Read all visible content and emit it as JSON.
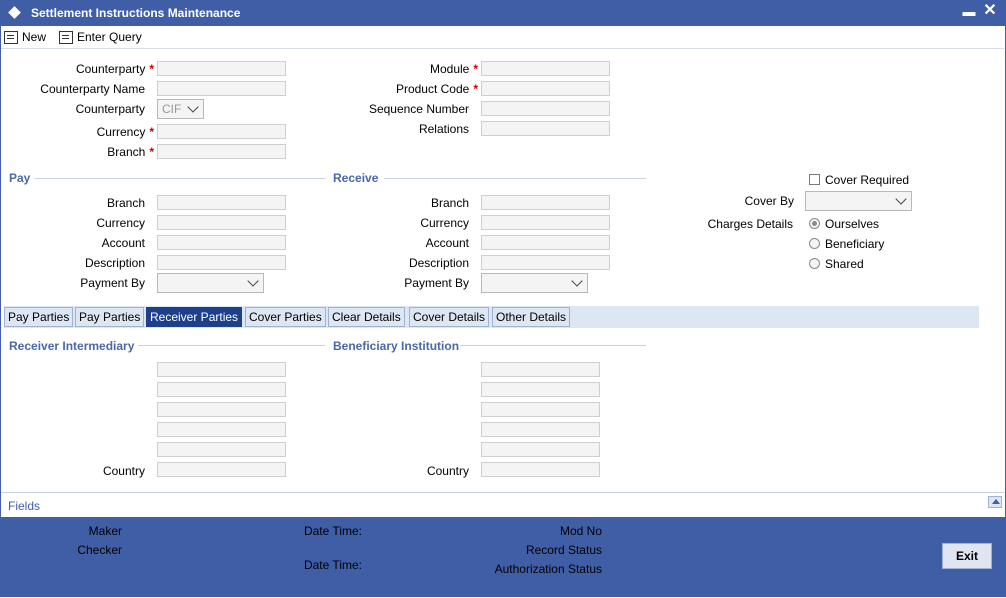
{
  "window": {
    "title": "Settlement Instructions Maintenance"
  },
  "toolbar": {
    "new_label": "New",
    "enter_query_label": "Enter Query"
  },
  "header_left": {
    "counterparty_label": "Counterparty",
    "counterparty_name_label": "Counterparty Name",
    "counterparty_type_label": "Counterparty",
    "counterparty_type_value": "CIF",
    "currency_label": "Currency",
    "branch_label": "Branch"
  },
  "header_right": {
    "module_label": "Module",
    "product_code_label": "Product Code",
    "sequence_number_label": "Sequence Number",
    "relations_label": "Relations"
  },
  "required_mark": "*",
  "pay": {
    "title": "Pay",
    "branch_label": "Branch",
    "currency_label": "Currency",
    "account_label": "Account",
    "description_label": "Description",
    "payment_by_label": "Payment By"
  },
  "receive": {
    "title": "Receive",
    "branch_label": "Branch",
    "currency_label": "Currency",
    "account_label": "Account",
    "description_label": "Description",
    "payment_by_label": "Payment By"
  },
  "cover": {
    "cover_required_label": "Cover Required",
    "cover_by_label": "Cover By",
    "charges_details_label": "Charges Details",
    "charges_options": [
      "Ourselves",
      "Beneficiary",
      "Shared"
    ],
    "charges_selected": "Ourselves"
  },
  "tabs": [
    {
      "label": "Pay Parties"
    },
    {
      "label": "Pay Parties"
    },
    {
      "label": "Receiver Parties",
      "active": true
    },
    {
      "label": "Cover Parties"
    },
    {
      "label": "Clear Details"
    },
    {
      "label": "Cover Details"
    },
    {
      "label": "Other Details"
    }
  ],
  "receiver_intermediary": {
    "title": "Receiver Intermediary",
    "country_label": "Country"
  },
  "beneficiary_institution": {
    "title": "Beneficiary Institution",
    "country_label": "Country"
  },
  "fields_bar": {
    "label": "Fields"
  },
  "footer": {
    "maker_label": "Maker",
    "checker_label": "Checker",
    "date_time_label_1": "Date Time:",
    "date_time_label_2": "Date Time:",
    "mod_no_label": "Mod No",
    "record_status_label": "Record Status",
    "authorization_status_label": "Authorization Status",
    "exit_label": "Exit"
  },
  "colors": {
    "title_bar": "#3f5ea6",
    "active_tab": "#1e3f8a",
    "section_title": "#4a67a8",
    "required": "#cc0000"
  }
}
